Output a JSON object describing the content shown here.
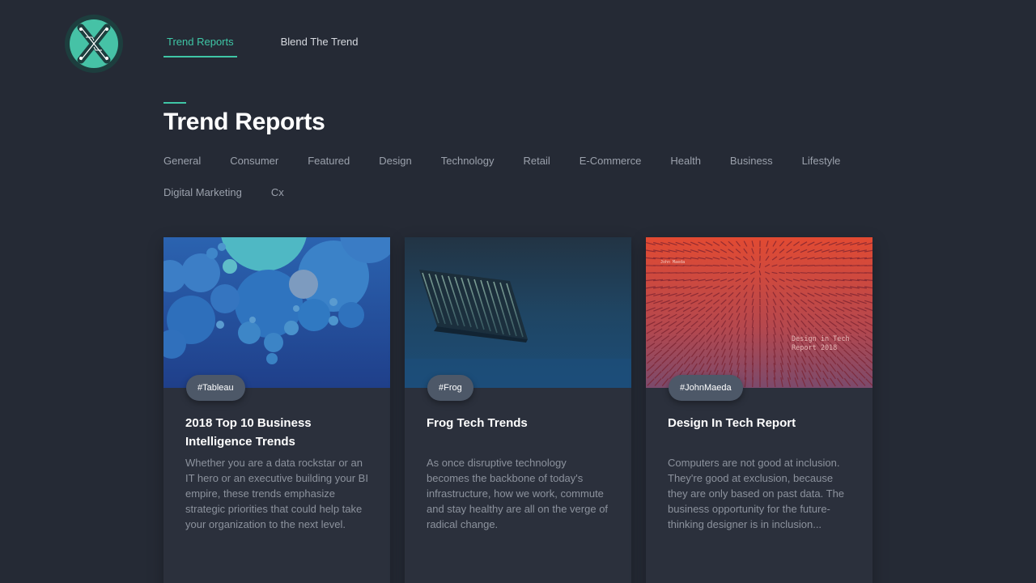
{
  "brand": {
    "logo_icon": "x-logo-icon",
    "accent": "#3fc6a6"
  },
  "nav": {
    "items": [
      {
        "label": "Trend Reports",
        "active": true
      },
      {
        "label": "Blend The Trend",
        "active": false
      }
    ]
  },
  "page": {
    "title": "Trend Reports"
  },
  "filters": [
    "General",
    "Consumer",
    "Featured",
    "Design",
    "Technology",
    "Retail",
    "E-Commerce",
    "Health",
    "Business",
    "Lifestyle",
    "Digital Marketing",
    "Cx"
  ],
  "cards": [
    {
      "tag": "#Tableau",
      "title": "2018 Top 10 Business Intelligence Trends",
      "body": "Whether you are a data rockstar or an IT hero or an executive building your BI empire, these trends emphasize strategic priorities that could help take your organization to the next level.",
      "image": "blue-bubbles-image"
    },
    {
      "tag": "#Frog",
      "title": "Frog Tech Trends",
      "body": "As once disruptive technology becomes the backbone of today's infrastructure, how we work, commute and stay healthy are all on the verge of radical change.",
      "image": "matrix-screen-image"
    },
    {
      "tag": "#JohnMaeda",
      "title": "Design In Tech Report",
      "body": "Computers are not good at inclusion. They're good at exclusion, because they are only based on past data. The business opportunity for the future-thinking designer is in inclusion...",
      "image": "red-lines-image",
      "image_text": {
        "author": "John Maeda",
        "line1": "Design in Tech",
        "line2": "Report 2018"
      }
    }
  ]
}
